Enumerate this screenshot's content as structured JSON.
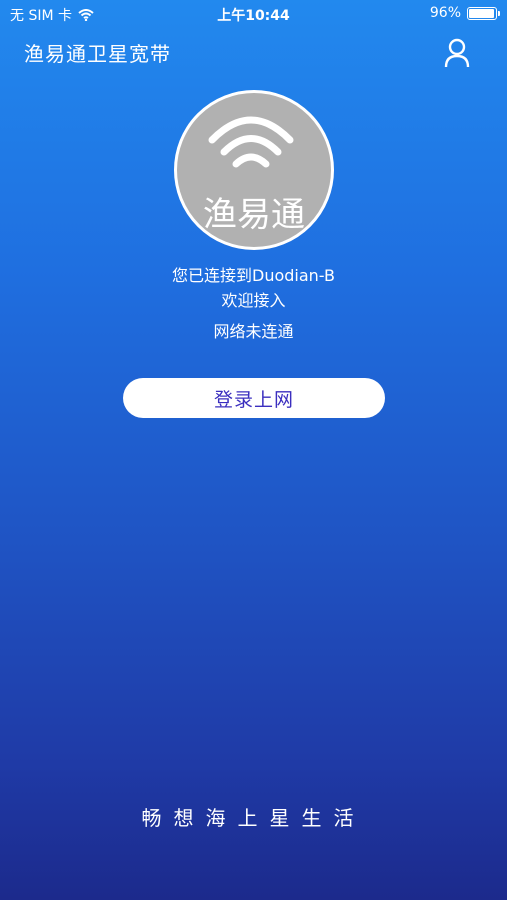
{
  "status_bar": {
    "carrier": "无 SIM 卡",
    "time": "上午10:44",
    "battery": "96%",
    "battery_level": 0.96
  },
  "header": {
    "title": "渔易通卫星宽带",
    "user_icon": "user-icon"
  },
  "logo": {
    "text": "渔易通",
    "icon": "wifi-icon"
  },
  "connection": {
    "connected_to": "您已连接到Duodian-B",
    "welcome": "欢迎接入",
    "network_status": "网络未连通"
  },
  "login": {
    "button_label": "登录上网"
  },
  "footer": {
    "slogan": "畅想海上星生活"
  },
  "colors": {
    "gradient_top": "#2289ee",
    "gradient_bottom": "#1c2a8c",
    "button_text": "#3b2fbf",
    "logo_gray": "#b1b1b1"
  }
}
